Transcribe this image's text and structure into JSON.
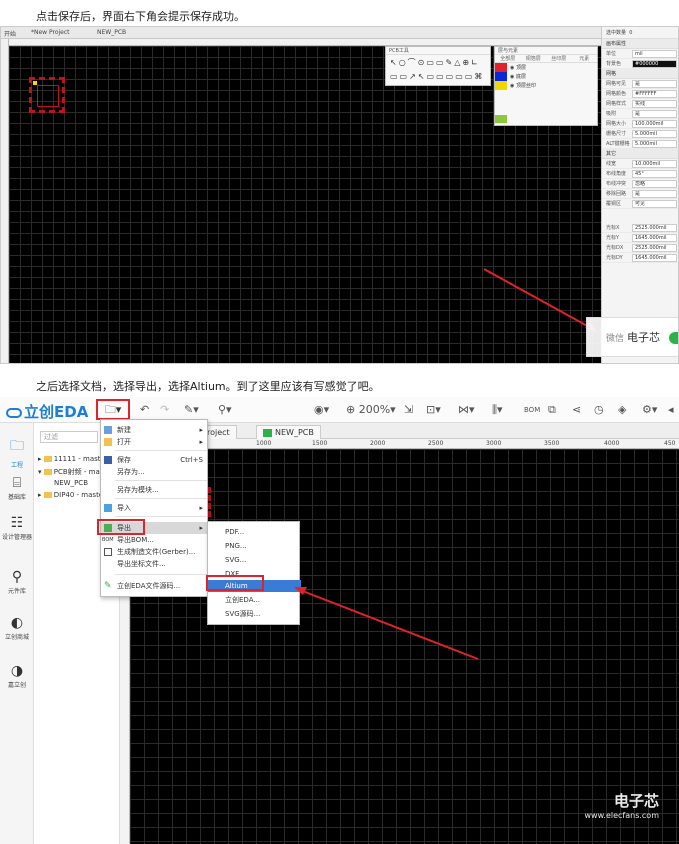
{
  "captions": {
    "first": "点击保存后，界面右下角会提示保存成功。",
    "second": "之后选择文档，选择导出，选择Altium。到了这里应该有写感觉了吧。"
  },
  "shot1": {
    "tabs": [
      "开始",
      "*New Project",
      "NEW_PCB"
    ],
    "pcb_tools": {
      "title": "PCB工具",
      "glyphs": "↖○⌒⊙▭▭✎△⊕∟",
      "glyphs2": "▭▭↗↖▭▭▭▭▭⌘"
    },
    "layers": {
      "title": "层与元素",
      "tabs": [
        "全部层",
        "铜箔层",
        "丝印层",
        "元素"
      ],
      "rows": [
        {
          "name": "顶层",
          "color": "#e0222b"
        },
        {
          "name": "底层",
          "color": "#0a27d6"
        },
        {
          "name": "顶层丝印",
          "color": "#f2d600"
        }
      ]
    },
    "properties": {
      "header": "选中数量",
      "header_count": "0",
      "sections": [
        {
          "title": "画布属性",
          "rows": [
            {
              "k": "单位",
              "v": "mil"
            },
            {
              "k": "背景色",
              "v": "#000000",
              "dark": true
            }
          ]
        },
        {
          "title": "网格",
          "rows": [
            {
              "k": "网格可见",
              "v": "是"
            },
            {
              "k": "网格颜色",
              "v": "#FFFFFF"
            },
            {
              "k": "网格样式",
              "v": "实线"
            },
            {
              "k": "吸附",
              "v": "是"
            },
            {
              "k": "网格大小",
              "v": "100.000mil"
            },
            {
              "k": "栅格尺寸",
              "v": "5.000mil"
            },
            {
              "k": "ALT键栅格",
              "v": "5.000mil"
            }
          ]
        },
        {
          "title": "其它",
          "rows": [
            {
              "k": "线宽",
              "v": "10.000mil"
            },
            {
              "k": "布线角度",
              "v": "45°"
            },
            {
              "k": "布线冲突",
              "v": "忽略"
            },
            {
              "k": "移除回路",
              "v": "是"
            },
            {
              "k": "覆铜区",
              "v": "可见"
            }
          ]
        }
      ],
      "coords": [
        {
          "k": "光标X",
          "v": "2525.000mil"
        },
        {
          "k": "光标Y",
          "v": "1645.000mil"
        },
        {
          "k": "光标DX",
          "v": "2525.000mil"
        },
        {
          "k": "光标DY",
          "v": "1645.000mil"
        }
      ]
    },
    "watermark": "电子芯",
    "watermark_prefix": "微信"
  },
  "shot2": {
    "logo": "立创EDA",
    "toolbar": {
      "file_icon": "🗀▾",
      "undo": "↶",
      "redo": "↷",
      "pencil": "✎▾",
      "pin": "⚲▾",
      "eye": "◉▾",
      "zoom": "⊕ 200%▾",
      "import": "⇲",
      "camera": "⊡▾",
      "share": "⋈▾",
      "bars": "⫼▾",
      "bom": "BOM",
      "chart": "⧉",
      "shares2": "⋖",
      "clock": "◷",
      "layers": "◈",
      "gear": "⚙▾",
      "more": "◂"
    },
    "sidebar": [
      {
        "icon": "🗀",
        "label": "工程"
      },
      {
        "icon": "⌸",
        "label": "基础库"
      },
      {
        "icon": "☷",
        "label": "设计管理器"
      },
      {
        "icon": "⚲",
        "label": "元件库"
      },
      {
        "icon": "◐",
        "label": "立创商城"
      },
      {
        "icon": "◑",
        "label": "嘉立创"
      }
    ],
    "project": {
      "filter_placeholder": "过滤",
      "nodes": [
        "11111 - master",
        "PCB射频 - ma",
        "NEW_PCB",
        "DIP40 - maste"
      ]
    },
    "tabs": [
      "roject",
      "NEW_PCB"
    ],
    "ruler": [
      "1000",
      "1500",
      "2000",
      "2500",
      "3000",
      "3500",
      "4000",
      "450"
    ],
    "menu": [
      {
        "label": "新建",
        "arrow": "▸"
      },
      {
        "label": "打开",
        "arrow": "▸"
      },
      {
        "label": "保存",
        "shortcut": "Ctrl+S"
      },
      {
        "label": "另存为..."
      },
      {
        "label": "另存为模块..."
      },
      {
        "label": "导入",
        "arrow": "▸"
      },
      {
        "label": "导出",
        "arrow": "▸",
        "active": true
      },
      {
        "label": "导出BOM...",
        "prefix": "BOM"
      },
      {
        "label": "生成制造文件(Gerber)..."
      },
      {
        "label": "导出坐标文件..."
      },
      {
        "label": "立创EDA文件源码..."
      }
    ],
    "submenu": [
      "PDF...",
      "PNG...",
      "SVG...",
      "DXF...",
      "Altium",
      "立创EDA...",
      "SVG源码..."
    ],
    "submenu_selected": "Altium",
    "watermark": "电子芯",
    "watermark_site": "www.elecfans.com"
  }
}
